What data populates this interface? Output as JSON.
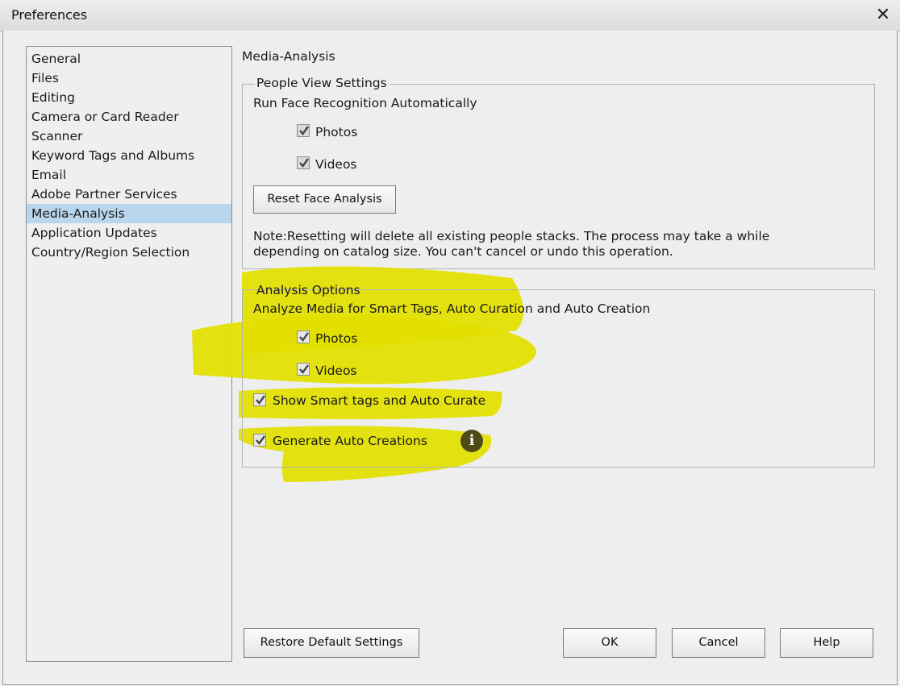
{
  "window": {
    "title": "Preferences",
    "close_glyph": "✕"
  },
  "sidebar": {
    "items": [
      {
        "label": "General"
      },
      {
        "label": "Files"
      },
      {
        "label": "Editing"
      },
      {
        "label": "Camera or Card Reader"
      },
      {
        "label": "Scanner"
      },
      {
        "label": "Keyword Tags and Albums"
      },
      {
        "label": "Email"
      },
      {
        "label": "Adobe Partner Services"
      },
      {
        "label": "Media-Analysis",
        "selected": true
      },
      {
        "label": "Application Updates"
      },
      {
        "label": "Country/Region Selection"
      }
    ]
  },
  "main": {
    "section_title": "Media-Analysis",
    "people_view": {
      "legend": "People View Settings",
      "run_label": "Run Face Recognition Automatically",
      "photos_label": "Photos",
      "photos_checked": true,
      "videos_label": "Videos",
      "videos_checked": true,
      "reset_button": "Reset Face Analysis",
      "note_line1": "Note:Resetting will delete all existing people stacks. The process may take a while",
      "note_line2": "depending on catalog size. You can't cancel or undo this operation."
    },
    "analysis_options": {
      "legend": "Analysis Options",
      "analyze_label": "Analyze Media for Smart Tags, Auto Curation and Auto Creation",
      "photos_label": "Photos",
      "photos_checked": true,
      "videos_label": "Videos",
      "videos_checked": true,
      "smart_tags_label": "Show Smart tags and Auto Curate",
      "smart_tags_checked": true,
      "auto_creations_label": "Generate Auto Creations",
      "auto_creations_checked": true,
      "info_glyph": "i"
    }
  },
  "footer": {
    "restore_button": "Restore Default Settings",
    "ok_button": "OK",
    "cancel_button": "Cancel",
    "help_button": "Help"
  },
  "colors": {
    "highlight": "#e3e000",
    "selection": "#b9d6ec"
  }
}
